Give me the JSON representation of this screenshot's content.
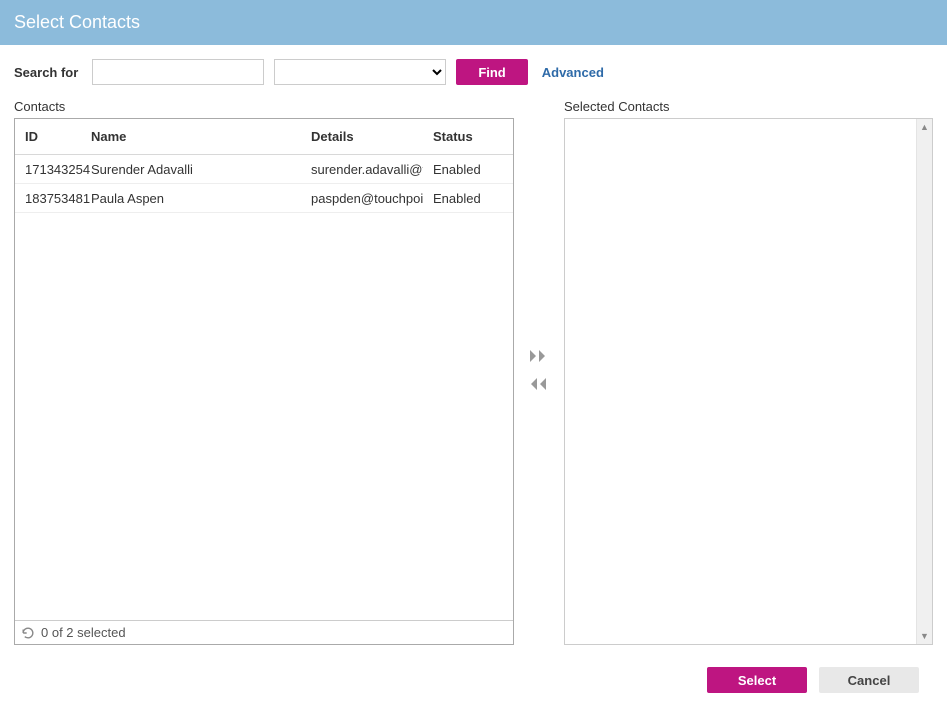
{
  "header": {
    "title": "Select Contacts"
  },
  "search": {
    "label": "Search for",
    "text_value": "",
    "select_value": "",
    "find_label": "Find",
    "advanced_label": "Advanced"
  },
  "contacts_panel": {
    "label": "Contacts",
    "columns": {
      "id": "ID",
      "name": "Name",
      "details": "Details",
      "status": "Status"
    },
    "rows": [
      {
        "id": "171343254",
        "name": "Surender Adavalli",
        "details": "surender.adavalli@tc",
        "status": "Enabled"
      },
      {
        "id": "183753481",
        "name": "Paula Aspen",
        "details": "paspden@touchpoir",
        "status": "Enabled"
      }
    ],
    "footer": "0 of 2 selected"
  },
  "selected_panel": {
    "label": "Selected Contacts"
  },
  "actions": {
    "select": "Select",
    "cancel": "Cancel"
  }
}
